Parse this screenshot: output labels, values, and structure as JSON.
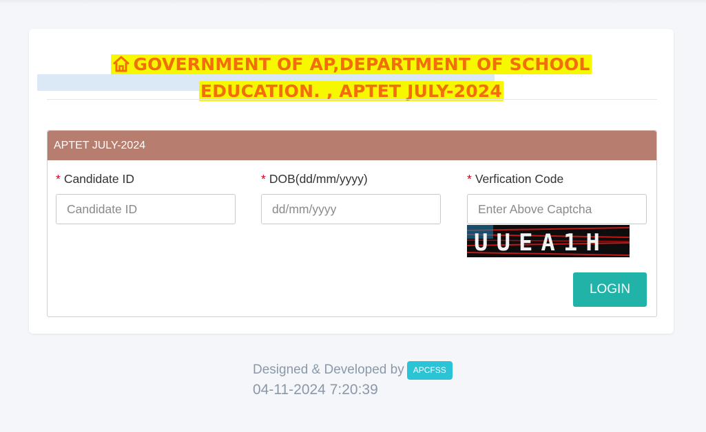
{
  "header": {
    "title_line1": "GOVERNMENT OF AP,DEPARTMENT OF SCHOOL",
    "title_line2": "EDUCATION. , APTET JULY-2024",
    "icon": "home-icon",
    "title_color": "#f26d0b",
    "highlight_color": "#f7f700"
  },
  "panel": {
    "title": "APTET JULY-2024",
    "header_color": "#b77e70"
  },
  "form": {
    "candidate_id": {
      "label": "Candidate ID",
      "placeholder": "Candidate ID",
      "value": ""
    },
    "dob": {
      "label": "DOB(dd/mm/yyyy)",
      "placeholder": "dd/mm/yyyy",
      "value": ""
    },
    "verification": {
      "label": "Verfication Code",
      "placeholder": "Enter Above Captcha",
      "value": ""
    },
    "required_marker": "*",
    "captcha_text": "UUEA1H",
    "login_label": "LOGIN",
    "login_color": "#22b3a8"
  },
  "footer": {
    "designed_by": "Designed & Developed by",
    "badge": "APCFSS",
    "timestamp": "04-11-2024 7:20:39"
  }
}
